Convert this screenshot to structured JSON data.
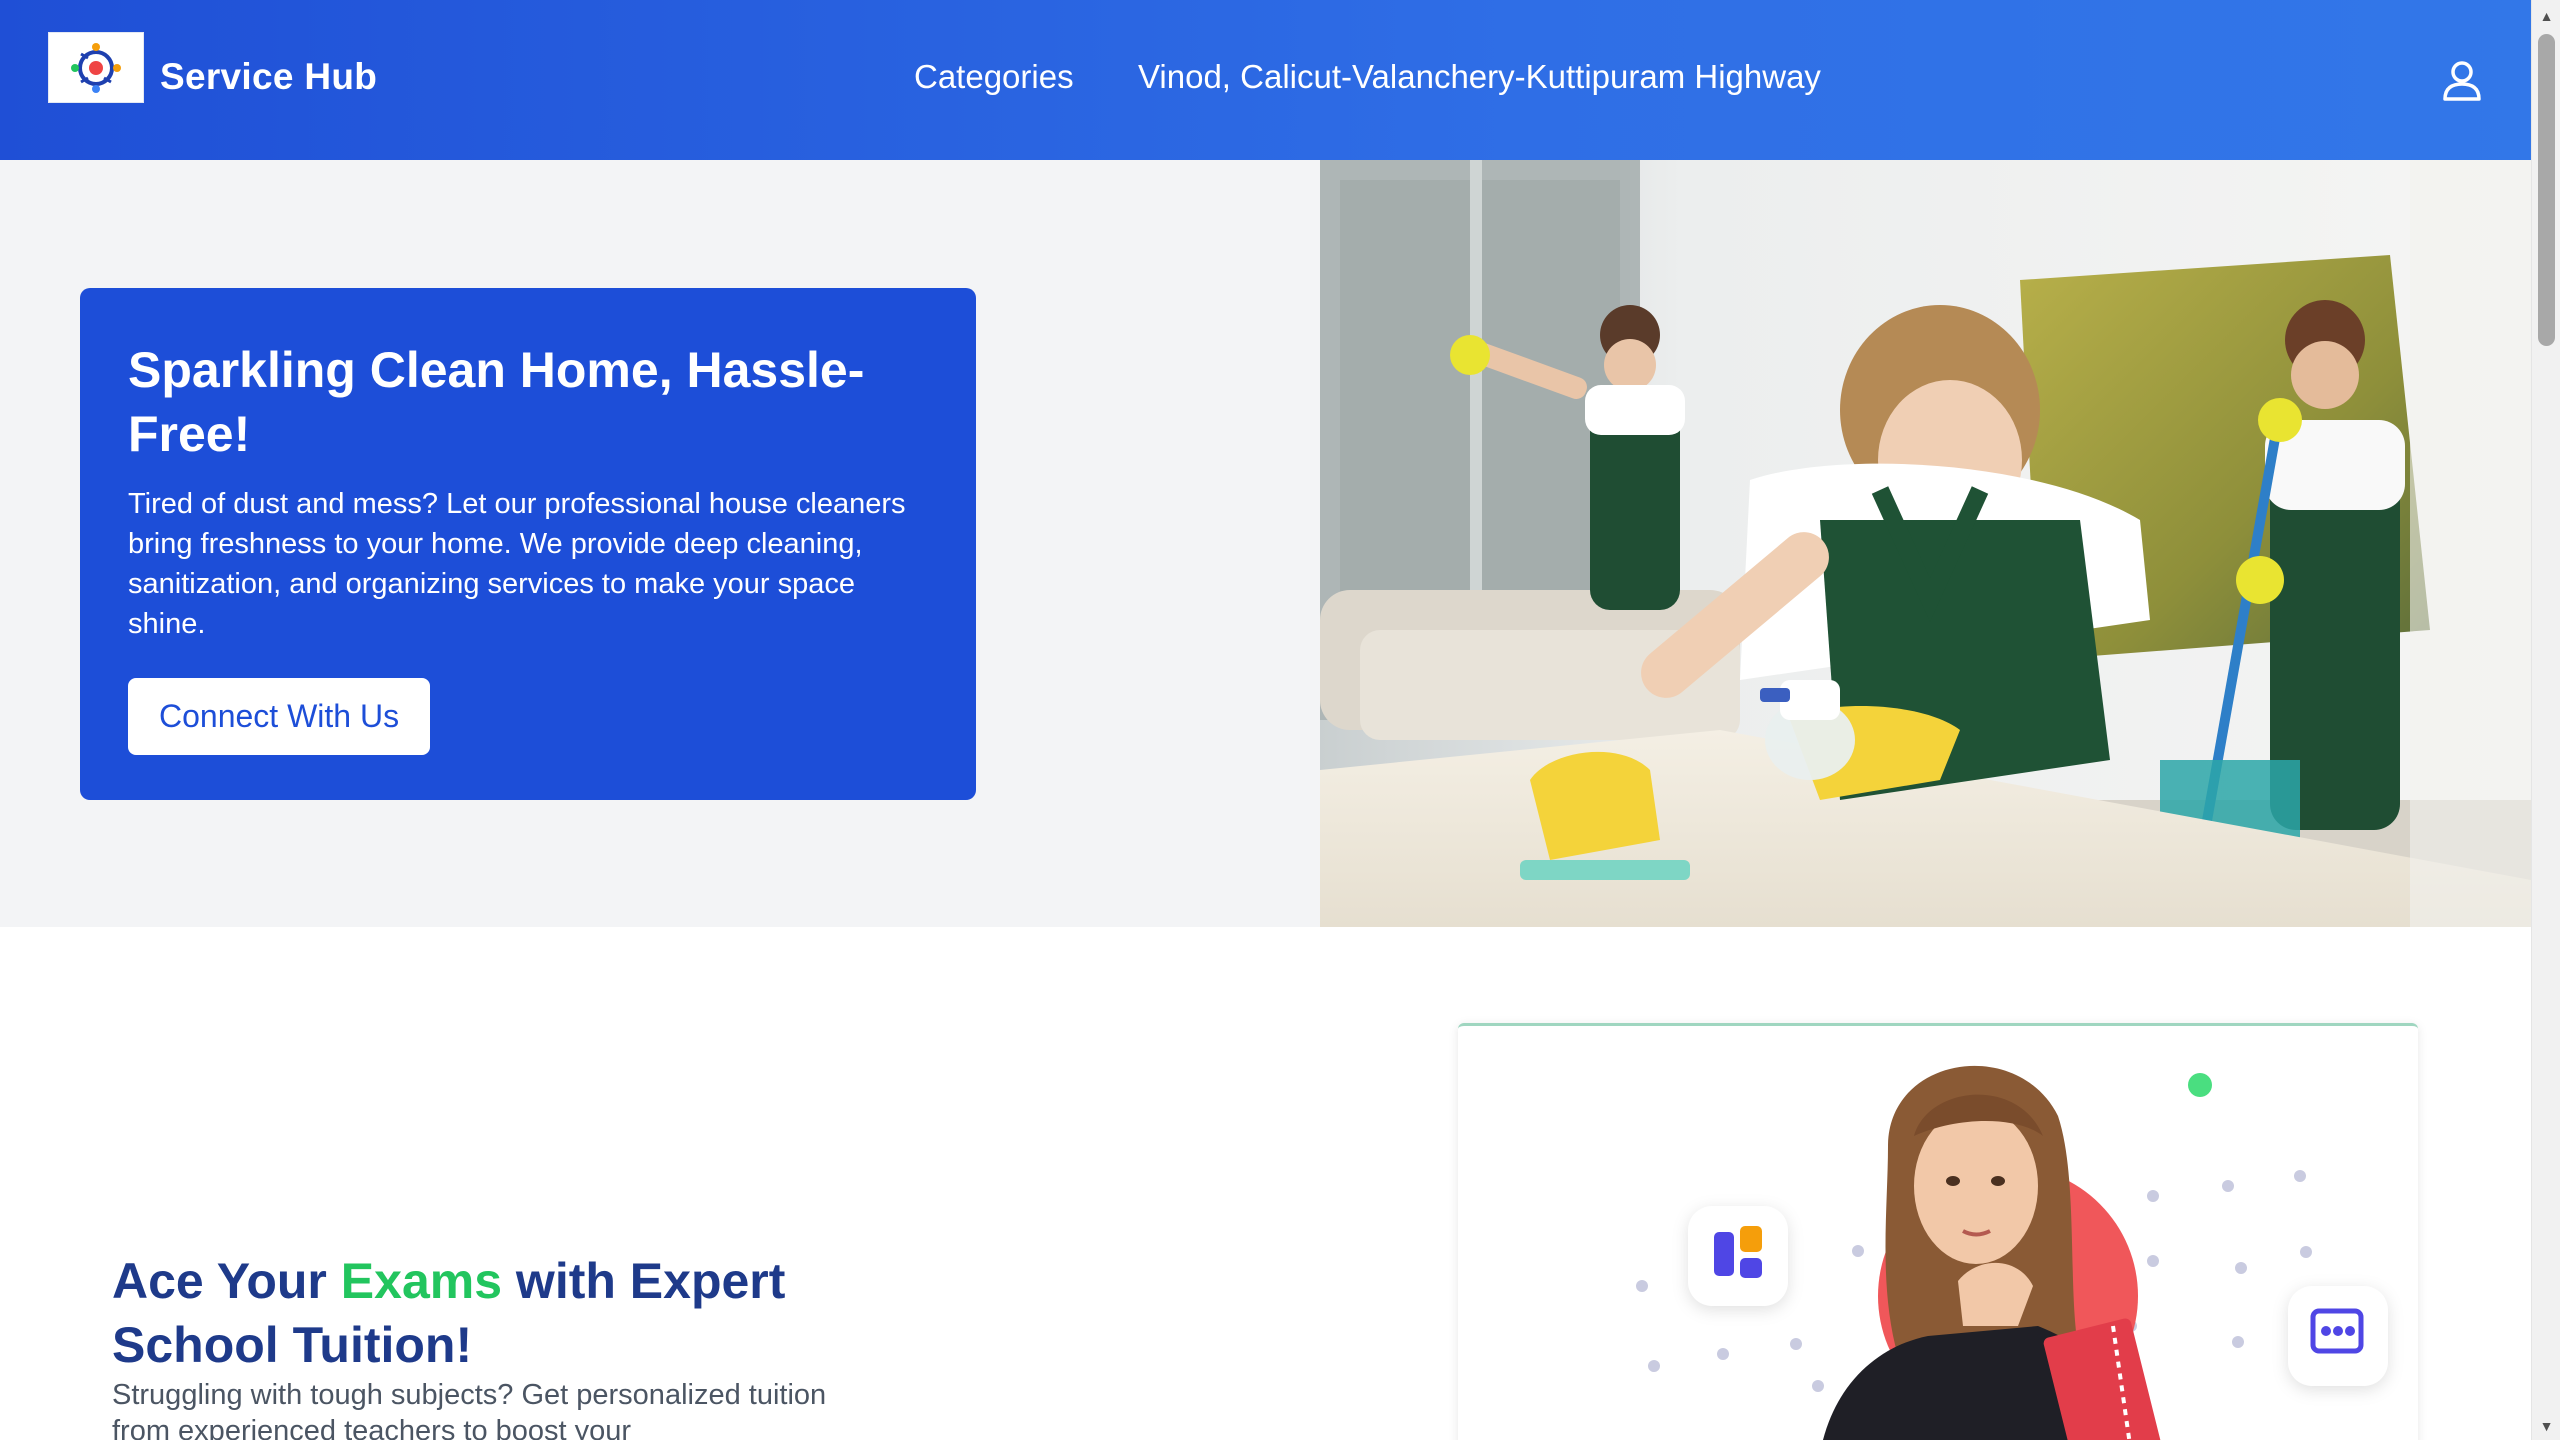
{
  "header": {
    "brand": "Service Hub",
    "nav_categories": "Categories",
    "nav_location": "Vinod, Calicut-Valanchery-Kuttipuram Highway",
    "accent_color": "#2563eb"
  },
  "hero": {
    "title": "Sparkling Clean Home, Hassle-Free!",
    "description": "Tired of dust and mess? Let our professional house cleaners bring freshness to your home. We provide deep cleaning, sanitization, and organizing services to make your space shine.",
    "button_label": "Connect With Us",
    "card_color": "#1d4ed8"
  },
  "tuition": {
    "title_before": "Ace Your ",
    "title_highlight": "Exams",
    "title_after": " with Expert School Tuition!",
    "description": "Struggling with tough subjects? Get personalized tuition from experienced teachers to boost your",
    "highlight_color": "#22c55e",
    "title_color": "#1e3a8a"
  },
  "icons": {
    "logo": "service-hub-logo",
    "user": "user-icon",
    "scroll_up": "▲",
    "scroll_down": "▼"
  }
}
